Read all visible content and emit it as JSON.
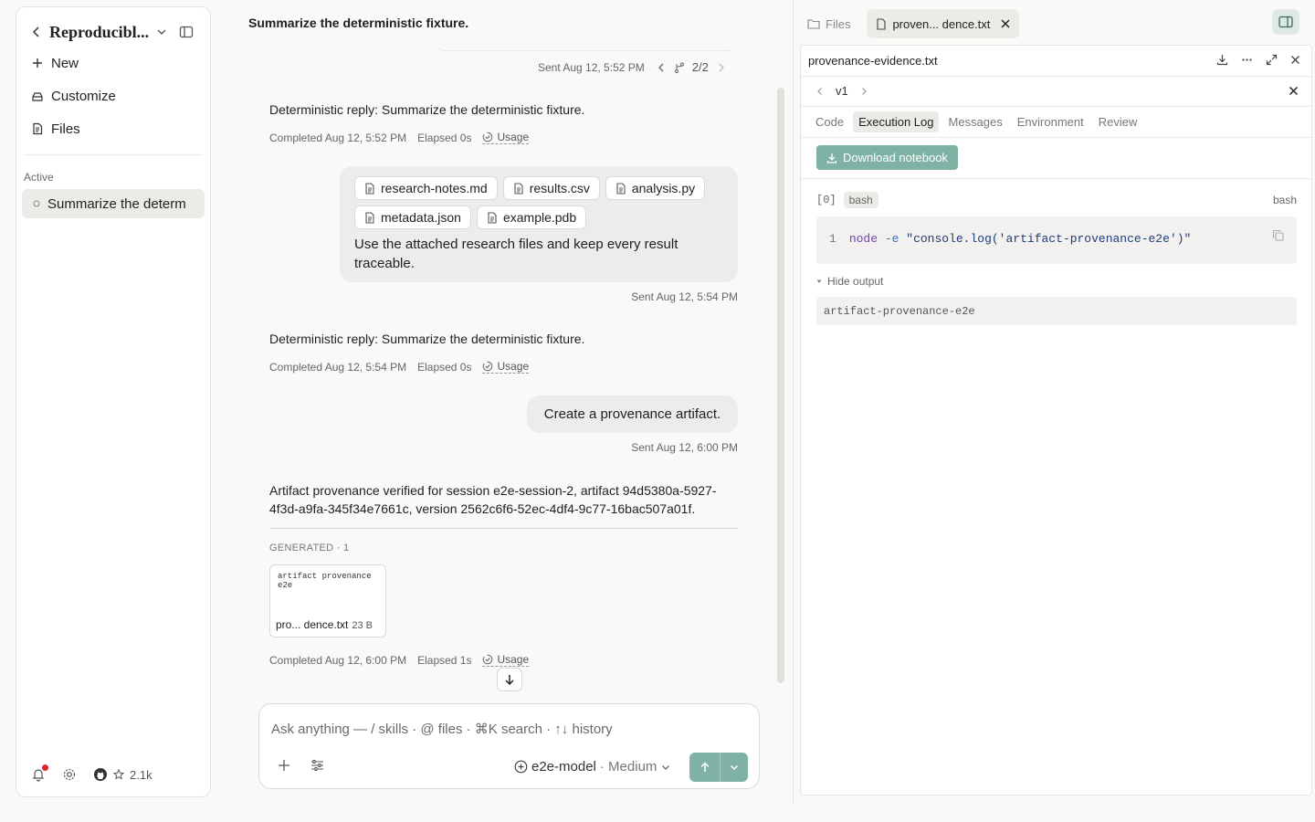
{
  "sidebar": {
    "project_title": "Reproducibl...",
    "new_label": "New",
    "customize_label": "Customize",
    "files_label": "Files",
    "active_label": "Active",
    "session_label": "Summarize the determ",
    "github_stars": "2.1k"
  },
  "chat": {
    "header": "Summarize the deterministic fixture.",
    "top_meta": {
      "sent": "Sent Aug 12, 5:52 PM",
      "branch": "2/2"
    },
    "msg1": {
      "text": "Deterministic reply: Summarize the deterministic fixture.",
      "completed": "Completed Aug 12, 5:52 PM",
      "elapsed": "Elapsed 0s",
      "usage": "Usage"
    },
    "user_files": [
      "research-notes.md",
      "results.csv",
      "analysis.py",
      "metadata.json",
      "example.pdb"
    ],
    "user_text": "Use the attached research files and keep every result traceable.",
    "user_sent": "Sent Aug 12, 5:54 PM",
    "msg2": {
      "text": "Deterministic reply: Summarize the deterministic fixture.",
      "completed": "Completed Aug 12, 5:54 PM",
      "elapsed": "Elapsed 0s",
      "usage": "Usage"
    },
    "user2_text": "Create a provenance artifact.",
    "user2_sent": "Sent Aug 12, 6:00 PM",
    "msg3": {
      "text": "Artifact provenance verified for session e2e-session-2, artifact 94d5380a-5927-4f3d-a9fa-345f34e7661c, version 2562c6f6-52ec-4df4-9c77-16bac507a01f.",
      "generated_label": "GENERATED · 1",
      "file_preview": "artifact provenance e2e",
      "file_name": "pro... dence.txt",
      "file_size": "23 B",
      "completed": "Completed Aug 12, 6:00 PM",
      "elapsed": "Elapsed 1s",
      "usage": "Usage"
    },
    "composer": {
      "placeholder": "Ask anything — / skills · @ files · ⌘K search · ↑↓ history",
      "model": "e2e-model",
      "effort": "· Medium"
    }
  },
  "panel": {
    "files_tab": "Files",
    "active_tab": "proven... dence.txt",
    "file_title": "provenance-evidence.txt",
    "version": "v1",
    "subtabs": [
      "Code",
      "Execution Log",
      "Messages",
      "Environment",
      "Review"
    ],
    "active_subtab": "Execution Log",
    "download_label": "Download notebook",
    "cell_index": "[0]",
    "cell_lang": "bash",
    "cell_kernel": "bash",
    "code": {
      "line_no": "1",
      "cmd": "node",
      "flag": "-e",
      "arg": "\"console.log('artifact-provenance-e2e')\""
    },
    "hide_output": "Hide output",
    "output": "artifact-provenance-e2e"
  },
  "colors": {
    "accent": "#7fb2a4",
    "bubble": "#edecea",
    "notif_dot": "#e0242b"
  },
  "icons": [
    "chevron-left-icon",
    "chevron-down-icon",
    "sidebar-toggle-icon",
    "plus-icon",
    "customize-icon",
    "file-icon",
    "bell-icon",
    "gear-icon",
    "github-icon",
    "star-icon",
    "branch-icon",
    "usage-icon",
    "arrow-down-icon",
    "sliders-icon",
    "send-icon",
    "download-icon",
    "more-icon",
    "expand-icon",
    "close-icon",
    "copy-icon",
    "folder-icon"
  ]
}
